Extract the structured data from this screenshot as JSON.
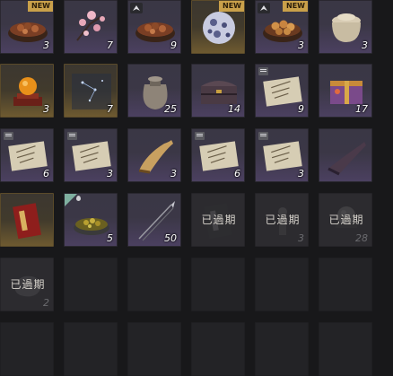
{
  "inventory": {
    "expired_label": "已過期",
    "new_label": "NEW",
    "rows": [
      [
        {
          "name": "food-bowl",
          "variant": "dark",
          "count": "3",
          "new": true,
          "upgrade": false
        },
        {
          "name": "plum-blossom",
          "variant": "dark",
          "count": "7",
          "new": false,
          "upgrade": false
        },
        {
          "name": "food-bowl",
          "variant": "dark",
          "count": "9",
          "new": false,
          "upgrade": true
        },
        {
          "name": "spotted-ball",
          "variant": "gold",
          "count": "",
          "new": true,
          "upgrade": false
        },
        {
          "name": "dumpling-bowl",
          "variant": "dark",
          "count": "3",
          "new": true,
          "upgrade": true
        },
        {
          "name": "lidded-jar",
          "variant": "dark",
          "count": "3",
          "new": false,
          "upgrade": false
        }
      ],
      [
        {
          "name": "orb-on-stand",
          "variant": "gold",
          "count": "3",
          "new": false,
          "upgrade": false
        },
        {
          "name": "starry-scroll",
          "variant": "gold",
          "count": "7",
          "new": false,
          "upgrade": false
        },
        {
          "name": "cloth-sack",
          "variant": "dark",
          "count": "25",
          "new": false,
          "upgrade": false
        },
        {
          "name": "treasure-chest",
          "variant": "dark",
          "count": "14",
          "new": false,
          "upgrade": false
        },
        {
          "name": "paper-scroll",
          "variant": "dark",
          "count": "9",
          "new": false,
          "upgrade": false,
          "tag": true
        },
        {
          "name": "gift-box",
          "variant": "dark",
          "count": "17",
          "new": false,
          "upgrade": false
        }
      ],
      [
        {
          "name": "paper-scroll",
          "variant": "dark",
          "count": "6",
          "new": false,
          "upgrade": false,
          "tag": true
        },
        {
          "name": "paper-scroll",
          "variant": "dark",
          "count": "3",
          "new": false,
          "upgrade": false,
          "tag": true
        },
        {
          "name": "horn",
          "variant": "dark",
          "count": "3",
          "new": false,
          "upgrade": false
        },
        {
          "name": "paper-scroll",
          "variant": "dark",
          "count": "6",
          "new": false,
          "upgrade": false,
          "tag": true
        },
        {
          "name": "paper-scroll",
          "variant": "dark",
          "count": "3",
          "new": false,
          "upgrade": false,
          "tag": true
        },
        {
          "name": "dark-horn",
          "variant": "dark",
          "count": "",
          "new": false,
          "upgrade": false
        }
      ],
      [
        {
          "name": "red-book",
          "variant": "gold",
          "count": "",
          "new": false,
          "upgrade": false
        },
        {
          "name": "herb-bowl",
          "variant": "dark",
          "count": "5",
          "new": false,
          "upgrade": false,
          "leaf": true
        },
        {
          "name": "spear",
          "variant": "dark",
          "count": "50",
          "new": false,
          "upgrade": false
        },
        {
          "name": "red-book",
          "variant": "expired",
          "count": "",
          "new": false,
          "upgrade": false
        },
        {
          "name": "lamp",
          "variant": "expired",
          "count": "3",
          "new": false,
          "upgrade": false
        },
        {
          "name": "orb-on-stand",
          "variant": "expired",
          "count": "28",
          "new": false,
          "upgrade": false
        }
      ],
      [
        {
          "name": "jade-stone",
          "variant": "expired",
          "count": "2",
          "new": false,
          "upgrade": false
        },
        {
          "name": "",
          "variant": "empty"
        },
        {
          "name": "",
          "variant": "empty"
        },
        {
          "name": "",
          "variant": "empty"
        },
        {
          "name": "",
          "variant": "empty"
        },
        {
          "name": "",
          "variant": "empty"
        }
      ],
      [
        {
          "name": "",
          "variant": "empty"
        },
        {
          "name": "",
          "variant": "empty"
        },
        {
          "name": "",
          "variant": "empty"
        },
        {
          "name": "",
          "variant": "empty"
        },
        {
          "name": "",
          "variant": "empty"
        },
        {
          "name": "",
          "variant": "empty"
        }
      ]
    ]
  }
}
